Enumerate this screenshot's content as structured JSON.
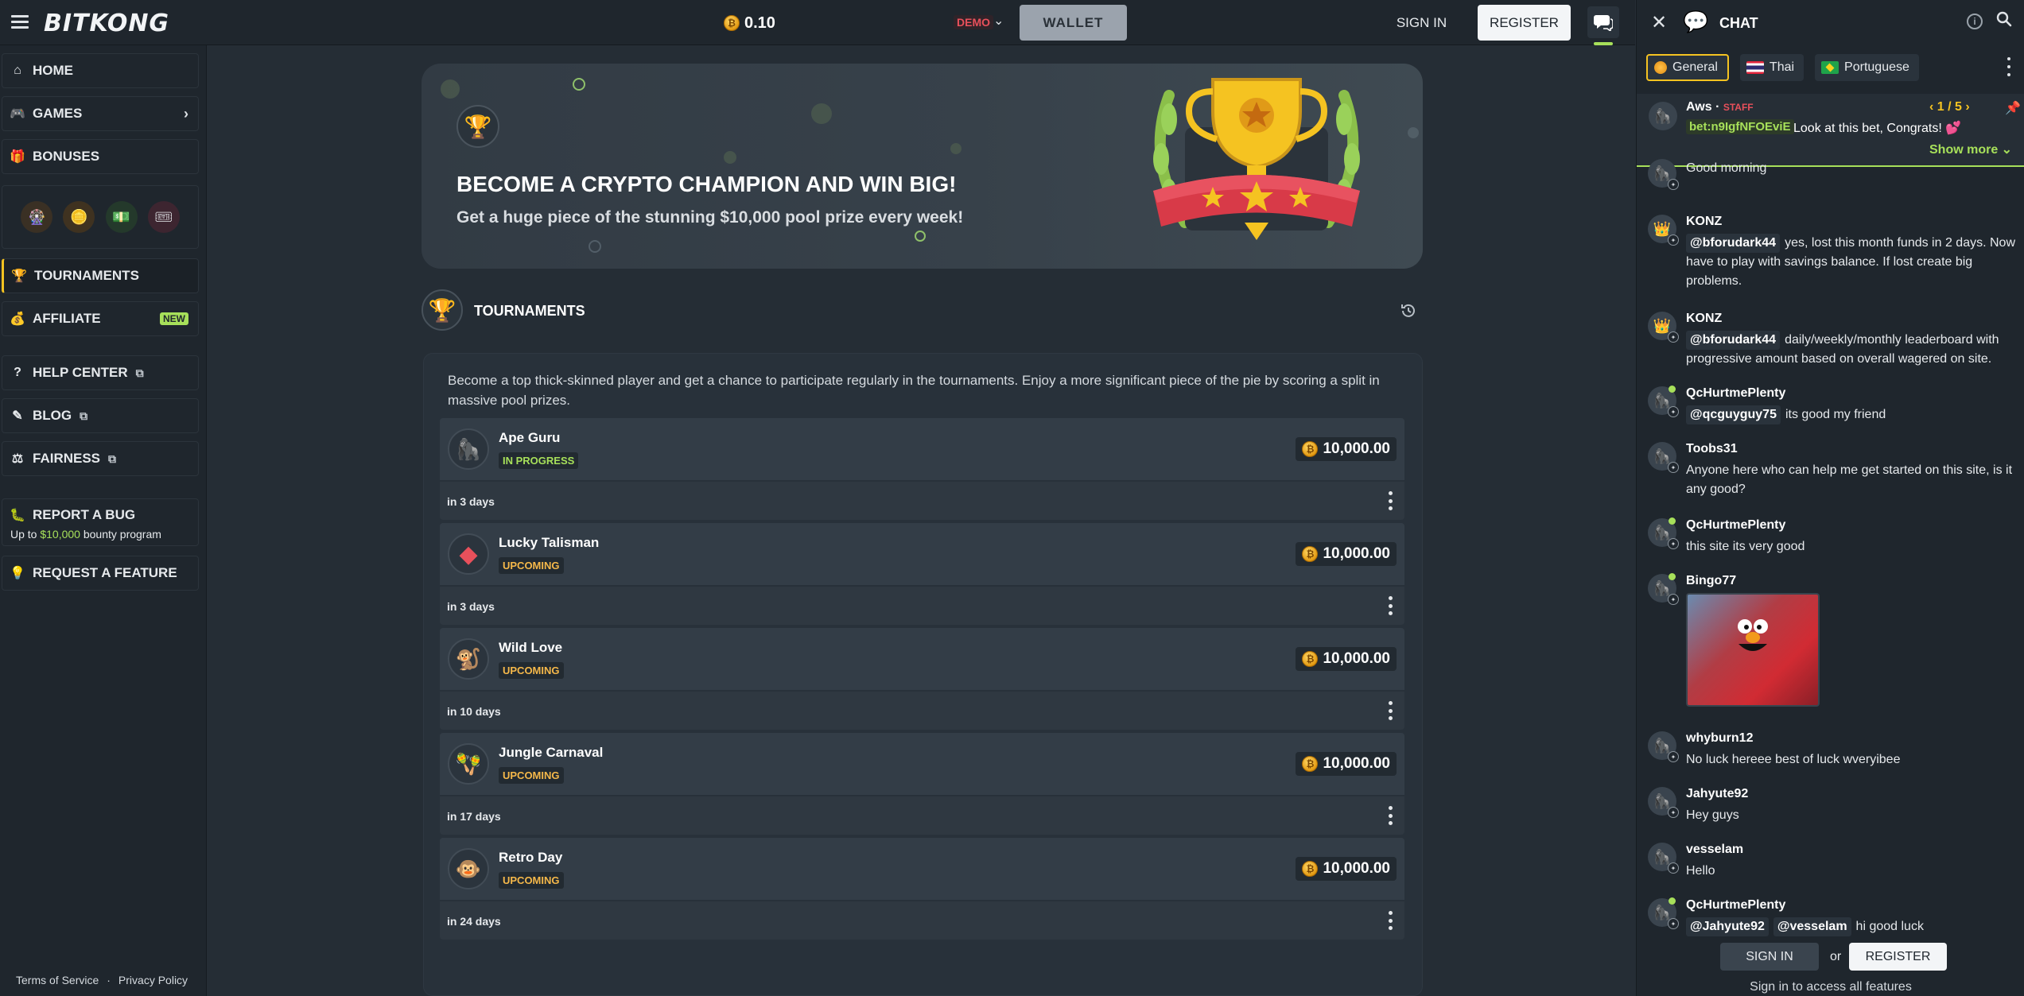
{
  "header": {
    "logo": "BITKONG",
    "balance": "0.10",
    "demo_label": "DEMO",
    "wallet_label": "WALLET",
    "signin_label": "SIGN IN",
    "register_label": "REGISTER"
  },
  "sidebar": {
    "home": "HOME",
    "games": "GAMES",
    "bonuses": "BONUSES",
    "tournaments": "TOURNAMENTS",
    "affiliate": "AFFILIATE",
    "new_badge": "NEW",
    "help_center": "HELP CENTER",
    "blog": "BLOG",
    "fairness": "FAIRNESS",
    "report_bug": "REPORT A BUG",
    "report_sub_prefix": "Up to ",
    "report_sub_amount": "$10,000",
    "report_sub_suffix": " bounty program",
    "request_feature": "REQUEST A FEATURE",
    "terms": "Terms of Service",
    "separator": "·",
    "privacy": "Privacy Policy"
  },
  "hero": {
    "title": "BECOME A CRYPTO CHAMPION AND WIN BIG!",
    "subtitle": "Get a huge piece of the stunning $10,000 pool prize every week!"
  },
  "tournaments": {
    "heading": "TOURNAMENTS",
    "description": "Become a top thick-skinned player and get a chance to participate regularly in the tournaments. Enjoy a more significant piece of the pie by scoring a split in massive pool prizes.",
    "items": [
      {
        "name": "Ape Guru",
        "status": "IN PROGRESS",
        "prize": "10,000.00",
        "days": "in 3 days",
        "icon": "ape-icon"
      },
      {
        "name": "Lucky Talisman",
        "status": "UPCOMING",
        "prize": "10,000.00",
        "days": "in 3 days",
        "icon": "gem-icon"
      },
      {
        "name": "Wild Love",
        "status": "UPCOMING",
        "prize": "10,000.00",
        "days": "in 10 days",
        "icon": "ape-heart-icon"
      },
      {
        "name": "Jungle Carnaval",
        "status": "UPCOMING",
        "prize": "10,000.00",
        "days": "in 17 days",
        "icon": "maraca-icon"
      },
      {
        "name": "Retro Day",
        "status": "UPCOMING",
        "prize": "10,000.00",
        "days": "in 24 days",
        "icon": "retro-ape-icon"
      }
    ]
  },
  "chat": {
    "title": "CHAT",
    "tabs": [
      {
        "label": "General"
      },
      {
        "label": "Thai"
      },
      {
        "label": "Portuguese"
      }
    ],
    "pinned": {
      "name": "Aws",
      "separator": "·",
      "role": "STAFF",
      "counter": "1 / 5",
      "tag": "bet:n9IgfNFOEviE",
      "text": "Look at this bet, Congrats! 💕",
      "show_more": "Show more"
    },
    "messages": [
      {
        "name": "",
        "mentions": [],
        "text": "Good morning"
      },
      {
        "name": "KONZ",
        "mentions": [
          "@bforudark44"
        ],
        "text": "yes, lost this month funds in 2 days. Now have to play with savings balance. If lost create big problems."
      },
      {
        "name": "KONZ",
        "mentions": [
          "@bforudark44"
        ],
        "text": "daily/weekly/monthly leaderboard with progressive amount based on overall wagered on site."
      },
      {
        "name": "QcHurtmePlenty",
        "mentions": [
          "@qcguyguy75"
        ],
        "text": "its good my friend"
      },
      {
        "name": "Toobs31",
        "mentions": [],
        "text": "Anyone here who can help me get started on this site, is it any good?"
      },
      {
        "name": "QcHurtmePlenty",
        "mentions": [],
        "text": "this site its very good"
      },
      {
        "name": "Bingo77",
        "mentions": [],
        "text": ""
      },
      {
        "name": "whyburn12",
        "mentions": [],
        "text": "No luck hereee best of luck wveryibee"
      },
      {
        "name": "Jahyute92",
        "mentions": [],
        "text": "Hey guys"
      },
      {
        "name": "vesselam",
        "mentions": [],
        "text": "Hello"
      },
      {
        "name": "QcHurtmePlenty",
        "mentions": [
          "@Jahyute92",
          "@vesselam"
        ],
        "text": "hi good luck"
      }
    ],
    "footer": {
      "signin": "SIGN IN",
      "or": "or",
      "register": "REGISTER",
      "access": "Sign in to access all features"
    }
  },
  "colors": {
    "accent_green": "#a7e05a",
    "accent_gold": "#f5c321",
    "staff_red": "#e8505b",
    "bg": "#252d35",
    "panel": "#1f262d"
  }
}
